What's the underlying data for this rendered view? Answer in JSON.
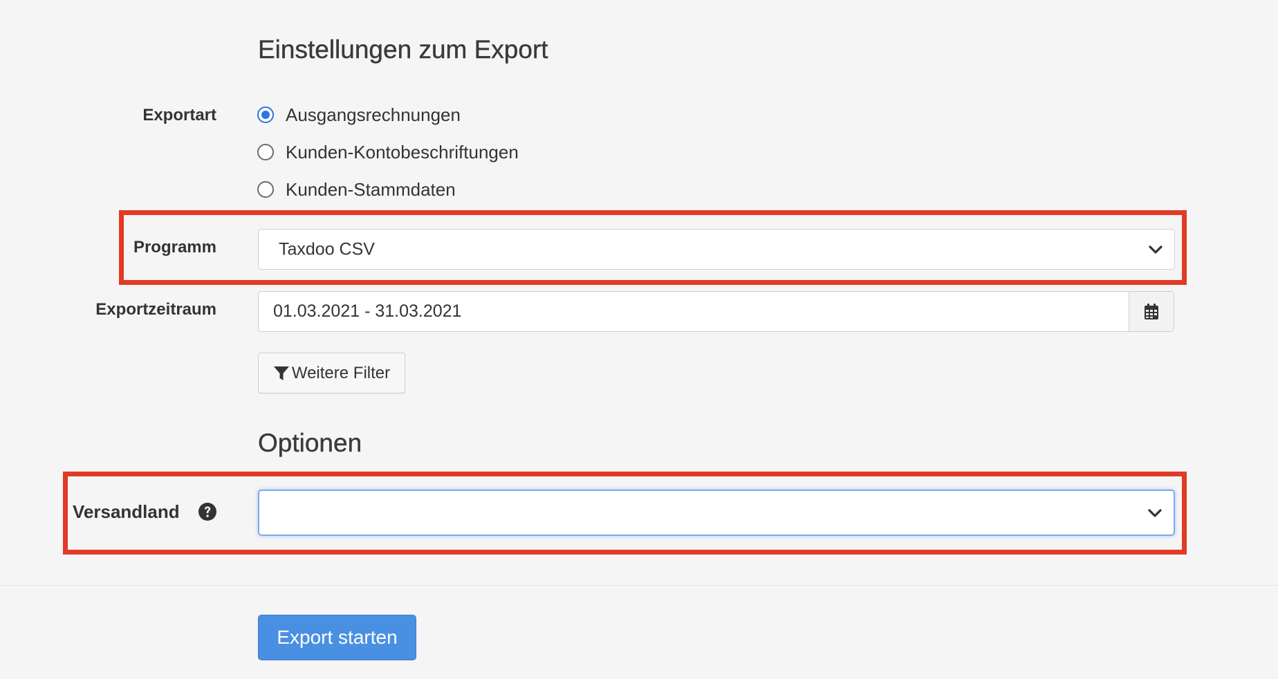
{
  "export_settings": {
    "heading": "Einstellungen zum Export",
    "export_type": {
      "label": "Exportart",
      "options": [
        {
          "label": "Ausgangsrechnungen",
          "checked": true
        },
        {
          "label": "Kunden-Kontobeschriftungen",
          "checked": false
        },
        {
          "label": "Kunden-Stammdaten",
          "checked": false
        }
      ]
    },
    "program": {
      "label": "Programm",
      "selected": "Taxdoo CSV"
    },
    "export_period": {
      "label": "Exportzeitraum",
      "value": "01.03.2021 - 31.03.2021"
    },
    "more_filters_label": "Weitere Filter"
  },
  "options": {
    "heading": "Optionen",
    "shipping_country": {
      "label": "Versandland",
      "selected": ""
    }
  },
  "actions": {
    "start_export_label": "Export starten"
  },
  "icons": {
    "calendar": "calendar-icon",
    "filter": "filter-icon",
    "help": "question-circle-icon",
    "chevron": "chevron-down-icon"
  },
  "colors": {
    "background": "#f5f5f5",
    "primary": "#4a90e2",
    "radio_checked": "#2f73e0",
    "highlight": "#e23a26",
    "focus_border": "#7aaaf0"
  }
}
